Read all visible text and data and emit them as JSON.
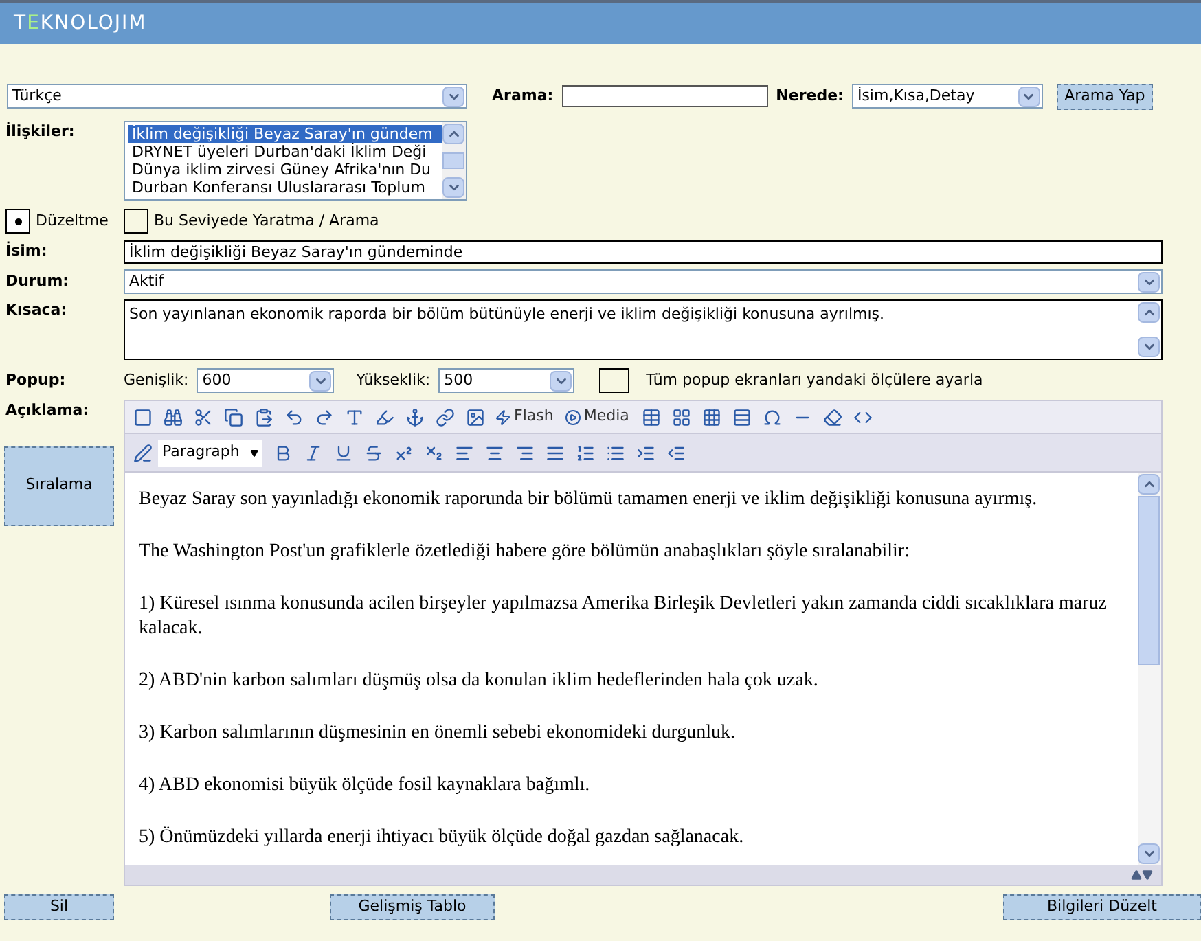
{
  "header": {
    "logo": [
      {
        "text": "T",
        "accent": false
      },
      {
        "text": "E",
        "accent": true
      },
      {
        "text": "KNOLOJIM",
        "accent": false
      }
    ]
  },
  "language_select": {
    "value": "Türkçe"
  },
  "search": {
    "label": "Arama:",
    "where_label": "Nerede:",
    "where_value": "İsim,Kısa,Detay",
    "button": "Arama Yap"
  },
  "relations": {
    "label": "İlişkiler:",
    "items": [
      {
        "text": "İklim değişikliği Beyaz Saray'ın gündem",
        "selected": true
      },
      {
        "text": "DRYNET üyeleri Durban'daki İklim Deği",
        "selected": false
      },
      {
        "text": "Dünya iklim zirvesi Güney Afrika'nın Du",
        "selected": false
      },
      {
        "text": "Durban Konferansı Uluslararası Toplum",
        "selected": false
      }
    ]
  },
  "mode": [
    {
      "label": "Düzeltme",
      "selected": true
    },
    {
      "label": "Bu Seviyede Yaratma / Arama",
      "selected": false
    }
  ],
  "name": {
    "label": "İsim:",
    "value": "İklim değişikliği Beyaz Saray'ın gündeminde"
  },
  "status": {
    "label": "Durum:",
    "value": "Aktif"
  },
  "summary": {
    "label": "Kısaca:",
    "value": "Son yayınlanan ekonomik raporda bir bölüm bütünüyle enerji ve iklim değişikliği konusuna ayrılmış."
  },
  "popup": {
    "label": "Popup:",
    "width_label": "Genişlik:",
    "width_value": "600",
    "height_label": "Yükseklik:",
    "height_value": "500",
    "apply_all": {
      "label": "Tüm popup ekranları yandaki ölçülere ayarla",
      "checked": false
    }
  },
  "description": {
    "label": "Açıklama:",
    "toolbar_flash": "Flash",
    "toolbar_media": "Media",
    "format_value": "Paragraph",
    "paragraphs": [
      "Beyaz Saray son yayınladığı ekonomik raporunda bir bölümü tamamen enerji ve iklim değişikliği konusuna ayırmış.",
      "The Washington Post'un grafiklerle özetlediği habere göre bölümün anabaşlıkları şöyle sıralanabilir:",
      "1) Küresel ısınma konusunda acilen birşeyler yapılmazsa Amerika Birleşik Devletleri yakın zamanda ciddi sıcaklıklara maruz kalacak.",
      "2) ABD'nin karbon salımları düşmüş olsa da konulan iklim hedeflerinden hala çok uzak.",
      "3) Karbon salımlarının düşmesinin en önemli sebebi ekonomideki durgunluk.",
      "4) ABD ekonomisi büyük ölçüde fosil kaynaklara bağımlı.",
      "5) Önümüzdeki yıllarda enerji ihtiyacı büyük ölçüde doğal gazdan sağlanacak."
    ]
  },
  "sort_button": "Sıralama",
  "footer_buttons": [
    "Sil",
    "Gelişmiş Tablo",
    "Bilgileri Düzelt"
  ]
}
